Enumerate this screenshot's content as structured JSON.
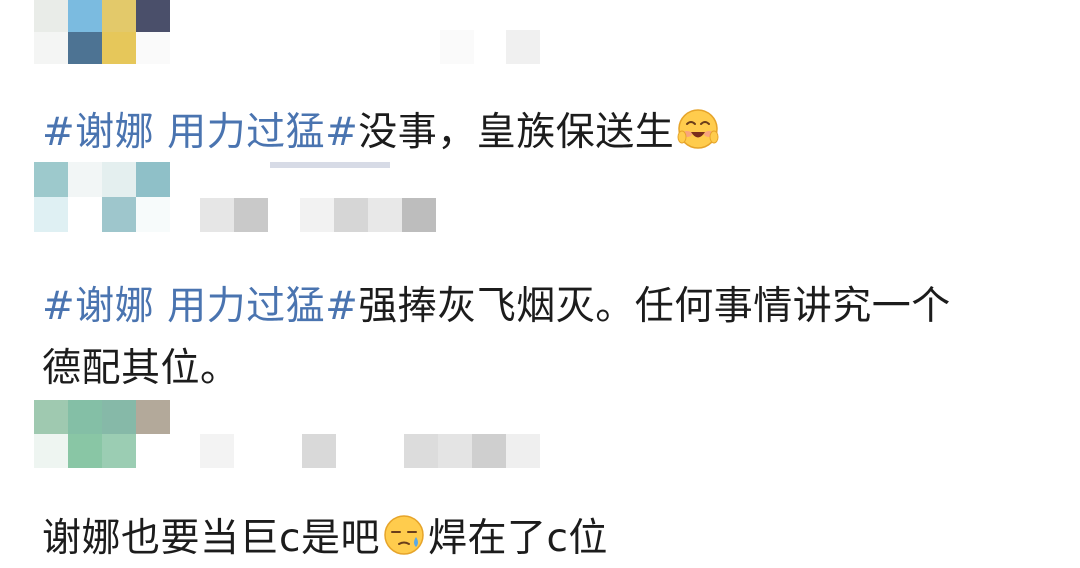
{
  "comments": [
    {
      "hashtag": "#谢娜 用力过猛#",
      "text": "没事，皇族保送生",
      "emoji": "laughing-blush-emoji"
    },
    {
      "hashtag": "#谢娜 用力过猛#",
      "text_line1": "强捧灰飞烟灭。任何事情讲究一个",
      "text_line2": "德配其位。"
    },
    {
      "text_before": "谢娜也要当巨c是吧",
      "emoji": "sweat-downcast-emoji",
      "text_after": "焊在了c位"
    }
  ],
  "colors": {
    "hashtag": "#4a74b0",
    "text": "#1c1c1c",
    "background": "#ffffff"
  }
}
